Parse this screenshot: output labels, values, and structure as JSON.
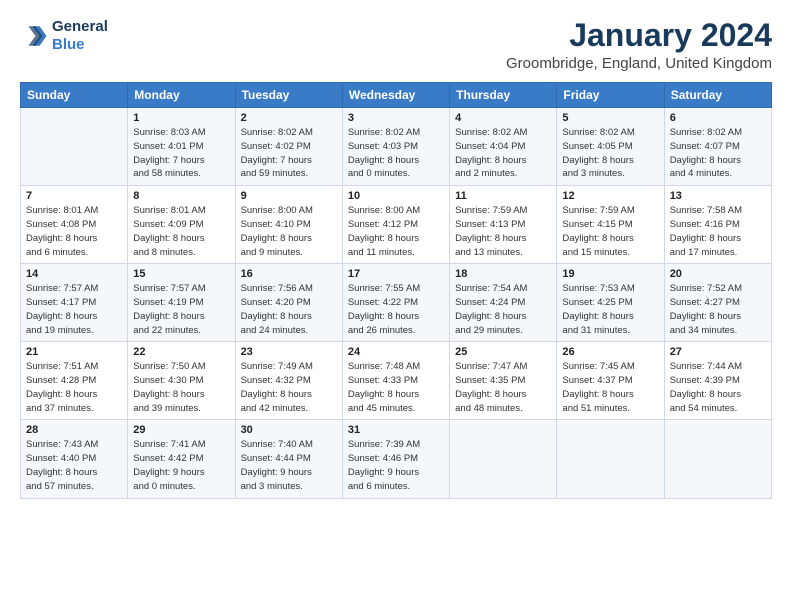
{
  "header": {
    "logo_line1": "General",
    "logo_line2": "Blue",
    "month_title": "January 2024",
    "location": "Groombridge, England, United Kingdom"
  },
  "days_of_week": [
    "Sunday",
    "Monday",
    "Tuesday",
    "Wednesday",
    "Thursday",
    "Friday",
    "Saturday"
  ],
  "weeks": [
    [
      {
        "day": "",
        "info": ""
      },
      {
        "day": "1",
        "info": "Sunrise: 8:03 AM\nSunset: 4:01 PM\nDaylight: 7 hours\nand 58 minutes."
      },
      {
        "day": "2",
        "info": "Sunrise: 8:02 AM\nSunset: 4:02 PM\nDaylight: 7 hours\nand 59 minutes."
      },
      {
        "day": "3",
        "info": "Sunrise: 8:02 AM\nSunset: 4:03 PM\nDaylight: 8 hours\nand 0 minutes."
      },
      {
        "day": "4",
        "info": "Sunrise: 8:02 AM\nSunset: 4:04 PM\nDaylight: 8 hours\nand 2 minutes."
      },
      {
        "day": "5",
        "info": "Sunrise: 8:02 AM\nSunset: 4:05 PM\nDaylight: 8 hours\nand 3 minutes."
      },
      {
        "day": "6",
        "info": "Sunrise: 8:02 AM\nSunset: 4:07 PM\nDaylight: 8 hours\nand 4 minutes."
      }
    ],
    [
      {
        "day": "7",
        "info": "Sunrise: 8:01 AM\nSunset: 4:08 PM\nDaylight: 8 hours\nand 6 minutes."
      },
      {
        "day": "8",
        "info": "Sunrise: 8:01 AM\nSunset: 4:09 PM\nDaylight: 8 hours\nand 8 minutes."
      },
      {
        "day": "9",
        "info": "Sunrise: 8:00 AM\nSunset: 4:10 PM\nDaylight: 8 hours\nand 9 minutes."
      },
      {
        "day": "10",
        "info": "Sunrise: 8:00 AM\nSunset: 4:12 PM\nDaylight: 8 hours\nand 11 minutes."
      },
      {
        "day": "11",
        "info": "Sunrise: 7:59 AM\nSunset: 4:13 PM\nDaylight: 8 hours\nand 13 minutes."
      },
      {
        "day": "12",
        "info": "Sunrise: 7:59 AM\nSunset: 4:15 PM\nDaylight: 8 hours\nand 15 minutes."
      },
      {
        "day": "13",
        "info": "Sunrise: 7:58 AM\nSunset: 4:16 PM\nDaylight: 8 hours\nand 17 minutes."
      }
    ],
    [
      {
        "day": "14",
        "info": "Sunrise: 7:57 AM\nSunset: 4:17 PM\nDaylight: 8 hours\nand 19 minutes."
      },
      {
        "day": "15",
        "info": "Sunrise: 7:57 AM\nSunset: 4:19 PM\nDaylight: 8 hours\nand 22 minutes."
      },
      {
        "day": "16",
        "info": "Sunrise: 7:56 AM\nSunset: 4:20 PM\nDaylight: 8 hours\nand 24 minutes."
      },
      {
        "day": "17",
        "info": "Sunrise: 7:55 AM\nSunset: 4:22 PM\nDaylight: 8 hours\nand 26 minutes."
      },
      {
        "day": "18",
        "info": "Sunrise: 7:54 AM\nSunset: 4:24 PM\nDaylight: 8 hours\nand 29 minutes."
      },
      {
        "day": "19",
        "info": "Sunrise: 7:53 AM\nSunset: 4:25 PM\nDaylight: 8 hours\nand 31 minutes."
      },
      {
        "day": "20",
        "info": "Sunrise: 7:52 AM\nSunset: 4:27 PM\nDaylight: 8 hours\nand 34 minutes."
      }
    ],
    [
      {
        "day": "21",
        "info": "Sunrise: 7:51 AM\nSunset: 4:28 PM\nDaylight: 8 hours\nand 37 minutes."
      },
      {
        "day": "22",
        "info": "Sunrise: 7:50 AM\nSunset: 4:30 PM\nDaylight: 8 hours\nand 39 minutes."
      },
      {
        "day": "23",
        "info": "Sunrise: 7:49 AM\nSunset: 4:32 PM\nDaylight: 8 hours\nand 42 minutes."
      },
      {
        "day": "24",
        "info": "Sunrise: 7:48 AM\nSunset: 4:33 PM\nDaylight: 8 hours\nand 45 minutes."
      },
      {
        "day": "25",
        "info": "Sunrise: 7:47 AM\nSunset: 4:35 PM\nDaylight: 8 hours\nand 48 minutes."
      },
      {
        "day": "26",
        "info": "Sunrise: 7:45 AM\nSunset: 4:37 PM\nDaylight: 8 hours\nand 51 minutes."
      },
      {
        "day": "27",
        "info": "Sunrise: 7:44 AM\nSunset: 4:39 PM\nDaylight: 8 hours\nand 54 minutes."
      }
    ],
    [
      {
        "day": "28",
        "info": "Sunrise: 7:43 AM\nSunset: 4:40 PM\nDaylight: 8 hours\nand 57 minutes."
      },
      {
        "day": "29",
        "info": "Sunrise: 7:41 AM\nSunset: 4:42 PM\nDaylight: 9 hours\nand 0 minutes."
      },
      {
        "day": "30",
        "info": "Sunrise: 7:40 AM\nSunset: 4:44 PM\nDaylight: 9 hours\nand 3 minutes."
      },
      {
        "day": "31",
        "info": "Sunrise: 7:39 AM\nSunset: 4:46 PM\nDaylight: 9 hours\nand 6 minutes."
      },
      {
        "day": "",
        "info": ""
      },
      {
        "day": "",
        "info": ""
      },
      {
        "day": "",
        "info": ""
      }
    ]
  ]
}
